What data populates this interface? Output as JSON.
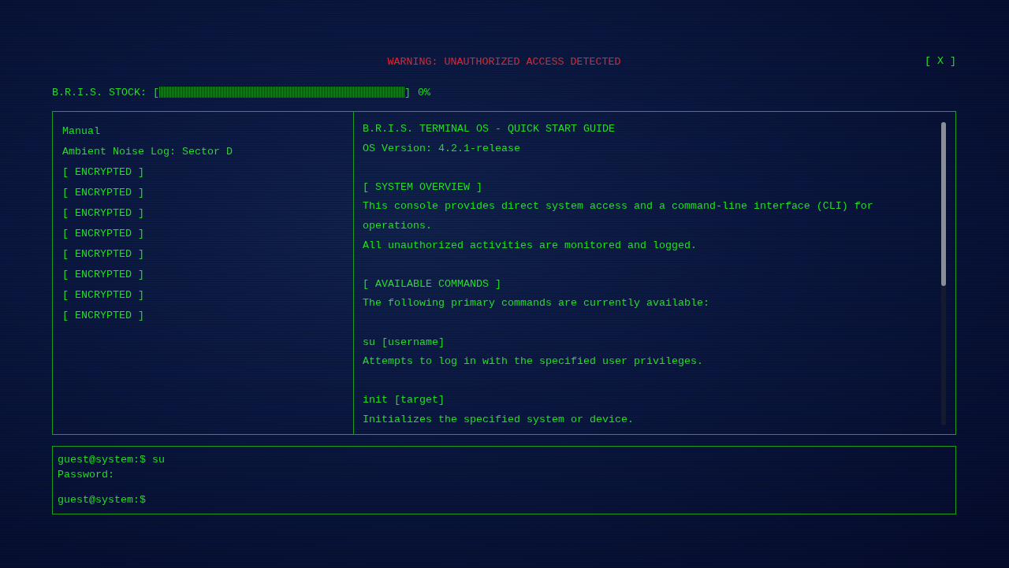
{
  "header": {
    "warning": "WARNING: UNAUTHORIZED ACCESS DETECTED",
    "close_button": "[ X ]"
  },
  "stock": {
    "label": "B.R.I.S. STOCK:",
    "bracket_open": "[",
    "level": 0,
    "bracket_close": "]",
    "reading": "0%"
  },
  "file_list": {
    "items": [
      "Manual",
      "Ambient Noise Log: Sector D",
      "[ ENCRYPTED ]",
      "[ ENCRYPTED ]",
      "[ ENCRYPTED ]",
      "[ ENCRYPTED ]",
      "[ ENCRYPTED ]",
      "[ ENCRYPTED ]",
      "[ ENCRYPTED ]",
      "[ ENCRYPTED ]"
    ]
  },
  "document": {
    "blocks": [
      {
        "lines": [
          "B.R.I.S. TERMINAL OS - QUICK START GUIDE",
          "OS Version: 4.2.1-release"
        ]
      },
      {
        "lines": [
          "[ SYSTEM OVERVIEW ]",
          "This console provides direct system access and a command-line interface (CLI) for operations.",
          "All unauthorized activities are monitored and logged."
        ]
      },
      {
        "lines": [
          "[ AVAILABLE COMMANDS ]",
          "The following primary commands are currently available:"
        ]
      },
      {
        "lines": [
          "su [username]",
          "Attempts to log in with the specified user privileges."
        ]
      },
      {
        "lines": [
          "init [target]",
          "Initializes the specified system or device."
        ]
      }
    ]
  },
  "terminal": {
    "history": [
      "guest@system:$ su",
      "Password:"
    ],
    "prompt": "guest@system:$"
  }
}
